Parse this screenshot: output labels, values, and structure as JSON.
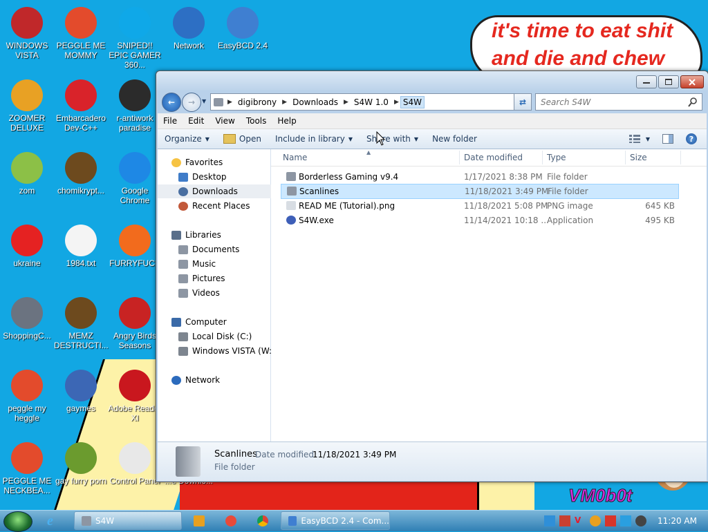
{
  "wallpaper": {
    "bubble_lines": [
      "it's time to eat shit",
      "and die and chew"
    ],
    "watermark": "VM0b0t"
  },
  "desktop_icons": [
    {
      "label": "WINDOWS VISTA",
      "icon": "lawnmower-icon",
      "color": "#c0282a"
    },
    {
      "label": "PEGGLE ME MOMMY",
      "icon": "peggle-icon",
      "color": "#e34b2c"
    },
    {
      "label": "SNIPED!! EPIC GAMER 360...",
      "icon": "skype-icon",
      "color": "#0fa8e8"
    },
    {
      "label": "Network",
      "icon": "network-globe-icon",
      "color": "#2d6fc4"
    },
    {
      "label": "EasyBCD 2.4",
      "icon": "easybcd-icon",
      "color": "#3f7fd1"
    },
    {
      "label": "ZOOMER DELUXE",
      "icon": "zoomer-icon",
      "color": "#e8a124"
    },
    {
      "label": "Embarcadero Dev-C++",
      "icon": "devcpp-icon",
      "color": "#d9232a"
    },
    {
      "label": "r-antiwork paradise",
      "icon": "reddit-icon",
      "color": "#2b2b2b"
    },
    {
      "label": "zom",
      "icon": "plant-icon",
      "color": "#8cc047"
    },
    {
      "label": "chomikrypt...",
      "icon": "hourglass-icon",
      "color": "#6d4a1e"
    },
    {
      "label": "Google Chrome",
      "icon": "chrome-icon",
      "color": "#1e88e5"
    },
    {
      "label": "ukraine",
      "icon": "radiation-icon",
      "color": "#e52222"
    },
    {
      "label": "1984.txt",
      "icon": "text-file-icon",
      "color": "#f4f4f4"
    },
    {
      "label": "FURRYFUCK",
      "icon": "firefox-icon",
      "color": "#f26b1d"
    },
    {
      "label": "ShoppingC...",
      "icon": "flash-icon",
      "color": "#6b7380"
    },
    {
      "label": "MEMZ DESTRUCTI...",
      "icon": "hourglass-icon",
      "color": "#6d4a1e"
    },
    {
      "label": "Angry Birds Seasons",
      "icon": "angry-birds-icon",
      "color": "#c82323"
    },
    {
      "label": "peggle my heggle",
      "icon": "peggle-icon",
      "color": "#e34b2c"
    },
    {
      "label": "gaymes",
      "icon": "games-icon",
      "color": "#3c67b5"
    },
    {
      "label": "Adobe Reader XI",
      "icon": "adobe-reader-icon",
      "color": "#c9171e"
    },
    {
      "label": "PEGGLE ME NECKBEA...",
      "icon": "peggle-icon",
      "color": "#e34b2c"
    },
    {
      "label": "gay furry porn",
      "icon": "bear-box-icon",
      "color": "#6b9b2e"
    },
    {
      "label": "Control Panel",
      "icon": "control-panel-icon",
      "color": "#e8e8e8"
    },
    {
      "label": "...e Downlo...",
      "icon": "download-icon",
      "color": "#3a8fd6"
    }
  ],
  "window": {
    "breadcrumb": [
      "digibrony",
      "Downloads",
      "S4W 1.0",
      "S4W"
    ],
    "search_placeholder": "Search S4W",
    "menu": [
      "File",
      "Edit",
      "View",
      "Tools",
      "Help"
    ],
    "commands": {
      "organize": "Organize",
      "open": "Open",
      "include": "Include in library",
      "share": "Share with",
      "new_folder": "New folder"
    },
    "nav": {
      "favorites": "Favorites",
      "desktop": "Desktop",
      "downloads": "Downloads",
      "recent": "Recent Places",
      "libraries": "Libraries",
      "documents": "Documents",
      "music": "Music",
      "pictures": "Pictures",
      "videos": "Videos",
      "computer": "Computer",
      "local_disk": "Local Disk (C:)",
      "vista_drive": "Windows VISTA (W:)",
      "network": "Network"
    },
    "columns": {
      "name": "Name",
      "date": "Date modified",
      "type": "Type",
      "size": "Size"
    },
    "files": [
      {
        "name": "Borderless Gaming v9.4",
        "date": "1/17/2021 8:38 PM",
        "type": "File folder",
        "size": "",
        "icon": "folder-icon"
      },
      {
        "name": "Scanlines",
        "date": "11/18/2021 3:49 PM",
        "type": "File folder",
        "size": "",
        "icon": "folder-icon",
        "selected": true
      },
      {
        "name": "READ ME (Tutorial).png",
        "date": "11/18/2021 5:08 PM",
        "type": "PNG image",
        "size": "645 KB",
        "icon": "image-file-icon"
      },
      {
        "name": "S4W.exe",
        "date": "11/14/2021 10:18 ...",
        "type": "Application",
        "size": "495 KB",
        "icon": "application-icon"
      }
    ],
    "details": {
      "name": "Scanlines",
      "date_label": "Date modified:",
      "date_value": "11/18/2021 3:49 PM",
      "type": "File folder"
    }
  },
  "taskbar": {
    "explorer_label": "S4W",
    "easybcd_label": "EasyBCD 2.4 - Com...",
    "clock": "11:20 AM"
  }
}
